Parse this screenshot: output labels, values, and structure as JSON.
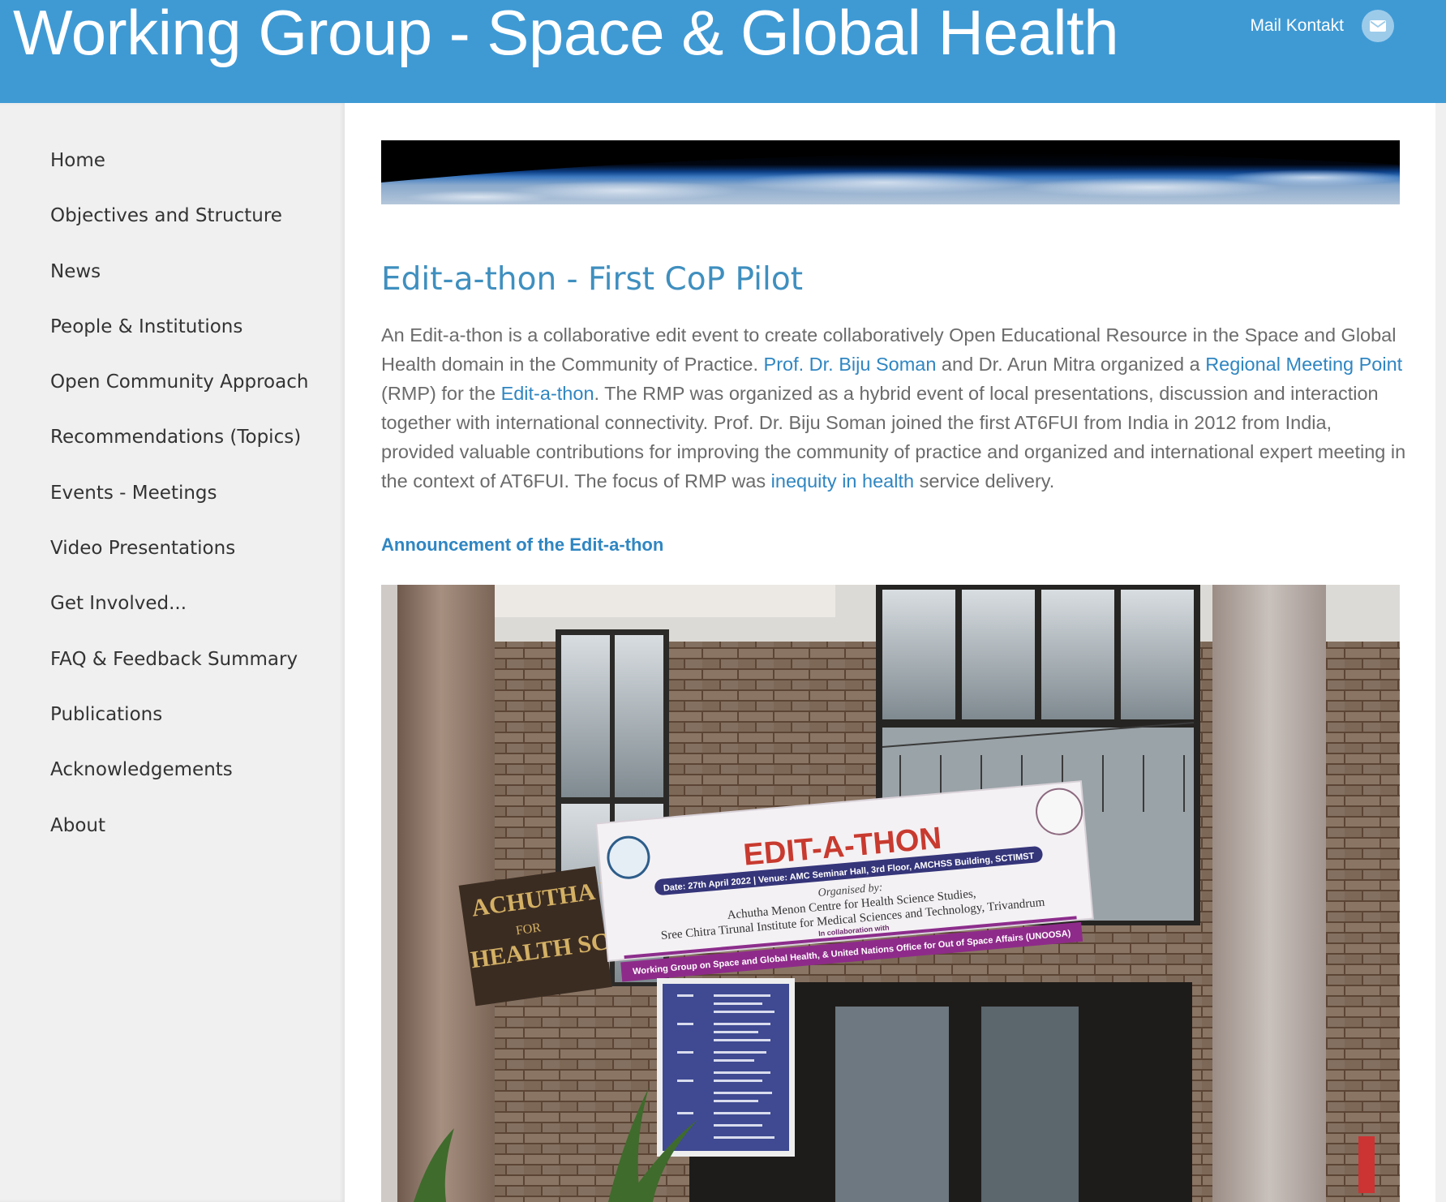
{
  "header": {
    "site_title": "Working Group - Space & Global Health",
    "contact_label": "Mail Kontakt",
    "contact_icon": "mail-icon"
  },
  "sidebar": {
    "items": [
      {
        "label": "Home"
      },
      {
        "label": "Objectives and Structure"
      },
      {
        "label": "News"
      },
      {
        "label": "People  &  Institutions"
      },
      {
        "label": "Open Community Approach"
      },
      {
        "label": "Recommendations (Topics)"
      },
      {
        "label": "Events - Meetings"
      },
      {
        "label": "Video Presentations"
      },
      {
        "label": "Get Involved..."
      },
      {
        "label": "FAQ  &  Feedback Summary"
      },
      {
        "label": "Publications"
      },
      {
        "label": "Acknowledgements"
      },
      {
        "label": "About"
      }
    ]
  },
  "main": {
    "heading": "Edit-a-thon - First CoP Pilot",
    "intro": {
      "t1": "An Edit-a-thon is a collaborative edit event to create collaboratively Open Educational Resource in the Space and Global Health domain in the Community of Practice. ",
      "link1": "Prof. Dr. Biju Soman",
      "t2": " and Dr. Arun Mitra organized a ",
      "link2": "Regional Meeting Point",
      "t3": " (RMP) for the ",
      "link3": "Edit-a-thon",
      "t4": ". The RMP was organized as a hybrid event of  local presentations, discussion and interaction together with international connectivity. Prof. Dr. Biju Soman joined the first AT6FUI from India in 2012 from India, provided valuable contributions for improving the community of practice and organized and international expert meeting in the context of AT6FUI. The focus of RMP was ",
      "link4": "inequity in health",
      "t5": " service delivery."
    },
    "announcement_heading": "Announcement of the Edit-a-thon",
    "photo_banner": {
      "title": "EDIT-A-THON",
      "date_venue": "Date: 27th April 2022 | Venue: AMC Seminar Hall, 3rd Floor, AMCHSS Building, SCTIMST",
      "organised_by": "Organised by:",
      "org_line_1": "Achutha Menon Centre for Health Science Studies,",
      "org_line_2": "Sree Chitra Tirunal Institute for Medical Sciences and Technology, Trivandrum",
      "collab_1": "In collaboration with",
      "collab_2": "Working Group on Space and Global Health, & United Nations Office for Out of Space Affairs (UNOOSA)"
    },
    "building_sign": {
      "line_1": "ACHUTHA MENON CENTRE",
      "line_2": "FOR",
      "line_3": "HEALTH SCIENCE STUDIES"
    }
  },
  "colors": {
    "header_bg": "#3f9ad4",
    "sidebar_bg": "#f0f0f0",
    "heading": "#3f8fbf",
    "link": "#2f86c2",
    "body_text": "#6b6b6b"
  }
}
